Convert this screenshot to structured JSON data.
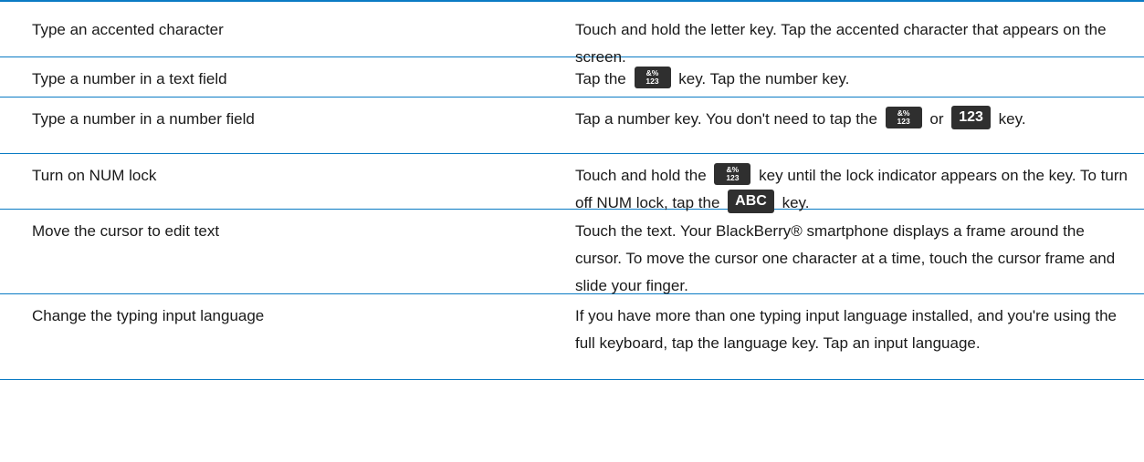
{
  "rows": [
    {
      "task": "Type an accented character",
      "steps_a": "Touch and hold the letter key. Tap the accented character that appears on the screen."
    },
    {
      "task": "Type a number in a text field",
      "steps_a": "Tap the",
      "steps_b": "key. Tap the number key."
    },
    {
      "task": "Type a number in a number field",
      "steps_a": "Tap a number key. You don't need to tap the",
      "steps_b": "or",
      "steps_c": "key."
    },
    {
      "task": "Turn on NUM lock",
      "steps_a": "Touch and hold the",
      "steps_b": "key until the lock indicator appears on the key. To turn off NUM lock, tap the",
      "steps_c": "key."
    },
    {
      "task": "Move the cursor to edit text",
      "steps_a": "Touch the text. Your BlackBerry® smartphone displays a frame around the cursor. To move the cursor one character at a time, touch the cursor frame and slide your finger."
    },
    {
      "task": "Change the typing input language",
      "steps_a": "If you have more than one typing input language installed, and you're using the full keyboard, tap the language key. Tap an input language."
    }
  ],
  "keys": {
    "symbol_top": "&%",
    "symbol_bottom": "123",
    "number": "123",
    "alpha": "ABC"
  },
  "colors": {
    "rule": "#0a7bc4",
    "key_bg": "#2f2f2f"
  }
}
